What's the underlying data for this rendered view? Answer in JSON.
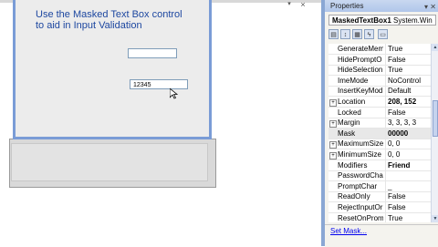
{
  "designer": {
    "form_text_line1": "Use the Masked Text Box control",
    "form_text_line2": "to aid in Input Validation",
    "textbox_value": "",
    "masked_textbox_value": "12345",
    "close_glyph": "×",
    "drop_glyph": "▾"
  },
  "properties": {
    "title": "Properties",
    "title_buttons": "▾ ✕",
    "object_name": "MaskedTextBox1",
    "object_type": "System.Win",
    "rows": [
      {
        "name": "GenerateMem",
        "value": "True",
        "expand": ""
      },
      {
        "name": "HidePromptO",
        "value": "False",
        "expand": ""
      },
      {
        "name": "HideSelection",
        "value": "True",
        "expand": ""
      },
      {
        "name": "ImeMode",
        "value": "NoControl",
        "expand": ""
      },
      {
        "name": "InsertKeyMod",
        "value": "Default",
        "expand": ""
      },
      {
        "name": "Location",
        "value": "208, 152",
        "expand": "+",
        "bold": true
      },
      {
        "name": "Locked",
        "value": "False",
        "expand": ""
      },
      {
        "name": "Margin",
        "value": "3, 3, 3, 3",
        "expand": "+"
      },
      {
        "name": "Mask",
        "value": "00000",
        "expand": "",
        "bold": true,
        "selected": true
      },
      {
        "name": "MaximumSize",
        "value": "0, 0",
        "expand": "+"
      },
      {
        "name": "MinimumSize",
        "value": "0, 0",
        "expand": "+"
      },
      {
        "name": "Modifiers",
        "value": "Friend",
        "expand": "",
        "bold": true
      },
      {
        "name": "PasswordCha",
        "value": "",
        "expand": ""
      },
      {
        "name": "PromptChar",
        "value": "_",
        "expand": ""
      },
      {
        "name": "ReadOnly",
        "value": "False",
        "expand": ""
      },
      {
        "name": "RejectInputOr",
        "value": "False",
        "expand": ""
      },
      {
        "name": "ResetOnProm",
        "value": "True",
        "expand": ""
      }
    ],
    "set_mask_link": "Set Mask..."
  },
  "colors": {
    "form_border": "#7a9cd6",
    "form_text": "#1d47a0",
    "link": "#0000ee"
  }
}
